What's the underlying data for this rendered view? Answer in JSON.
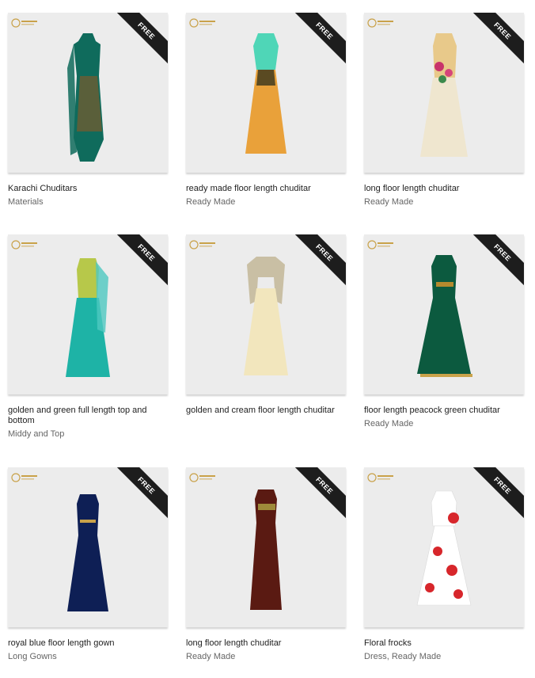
{
  "badge_text": "FREE",
  "products": [
    {
      "title": "Karachi Chuditars",
      "category": "Materials"
    },
    {
      "title": "ready made floor length chuditar",
      "category": "Ready Made"
    },
    {
      "title": "long floor length chuditar",
      "category": "Ready Made"
    },
    {
      "title": "golden and green full length top and bottom",
      "category": "Middy and Top"
    },
    {
      "title": "golden and cream floor length chuditar",
      "category": ""
    },
    {
      "title": "floor length peacock green chuditar",
      "category": "Ready Made"
    },
    {
      "title": "royal blue floor length gown",
      "category": "Long Gowns"
    },
    {
      "title": "long floor length chuditar",
      "category": "Ready Made"
    },
    {
      "title": "Floral frocks",
      "category": "Dress, Ready Made"
    }
  ],
  "colors": {
    "thumb_bg": "#ececec",
    "ribbon": "#1d1d1d",
    "dress_1": "#0f6b5c",
    "dress_2": "#e9a13a",
    "dress_3": "#efe6cf",
    "dress_4": "#1eb3a6",
    "dress_5": "#f2e6bd",
    "dress_6": "#0c5a3f",
    "dress_7": "#0e1f55",
    "dress_8": "#5a1a12",
    "dress_9": "#ffffff"
  }
}
